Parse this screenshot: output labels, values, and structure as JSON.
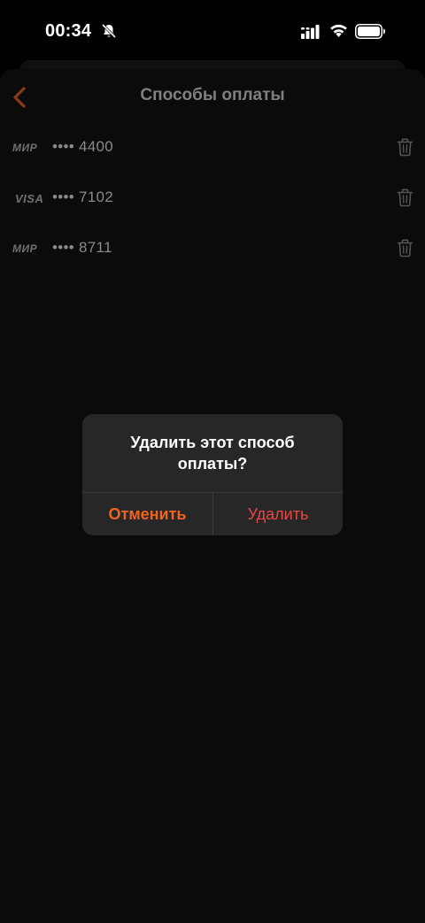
{
  "status_bar": {
    "time": "00:34"
  },
  "header": {
    "title": "Способы оплаты",
    "back_icon": "chevron-left-icon"
  },
  "cards": [
    {
      "brand": "МИР",
      "number": "•••• 4400"
    },
    {
      "brand": "VISA",
      "number": "•••• 7102"
    },
    {
      "brand": "МИР",
      "number": "•••• 8711"
    }
  ],
  "alert": {
    "title": "Удалить этот способ оплаты?",
    "cancel_label": "Отменить",
    "delete_label": "Удалить"
  },
  "colors": {
    "accent": "#f0641e",
    "destructive": "#ea4646",
    "background": "#0b0b0b",
    "alert_background": "#272727"
  }
}
